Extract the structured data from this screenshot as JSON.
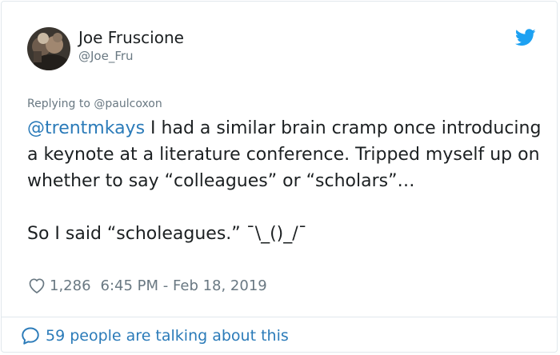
{
  "author": {
    "name": "Joe Fruscione",
    "handle": "@Joe_Fru"
  },
  "reply": {
    "prefix": "Replying to ",
    "to_handle": "@paulcoxon"
  },
  "tweet": {
    "mention": "@trentmkays",
    "text": " I had a similar brain cramp once introducing a keynote at a literature conference. Tripped myself up on whether to say “colleagues” or “scholars”…\n\nSo I said “scholeagues.” ¯\\_()_/¯"
  },
  "meta": {
    "likes": "1,286",
    "timestamp": "6:45 PM - Feb 18, 2019"
  },
  "footer": {
    "label": "59 people are talking about this"
  },
  "icons": {
    "brand": "twitter-bird-icon",
    "like": "heart-icon",
    "conversation": "speech-bubble-icon"
  },
  "colors": {
    "link": "#2b7bb9",
    "secondary_text": "#697882",
    "border": "#e1e8ed",
    "twitter_blue": "#1da1f2"
  }
}
